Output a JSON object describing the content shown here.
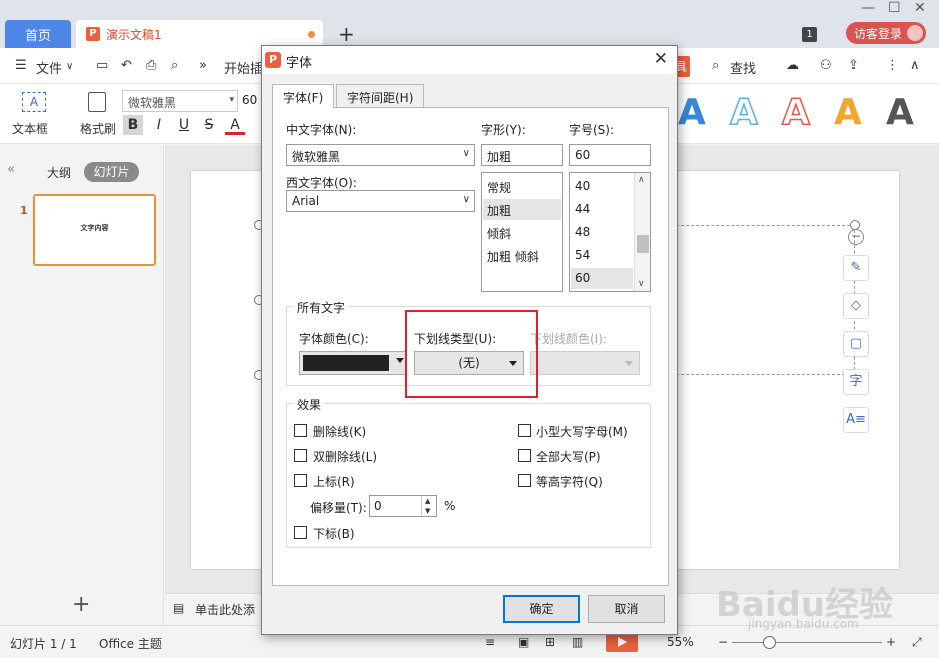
{
  "titlebar": {
    "home_tab": "首页",
    "doc_tab": "演示文稿1",
    "doc_icon": "P",
    "add_tab": "+",
    "badge": "1",
    "login": "访客登录"
  },
  "menubar": {
    "file": "文件",
    "start": "开始",
    "insert_partial": "插",
    "tools_tag": "具",
    "search": "查找",
    "more": "»"
  },
  "ribbon": {
    "textbox_label": "文本框",
    "format_painter": "格式刷",
    "font_name": "微软雅黑",
    "font_size": "60",
    "bold": "B",
    "italic": "I",
    "underline": "U",
    "strike": "S",
    "color_a": "A",
    "art_letters": [
      "A",
      "A",
      "A",
      "A",
      "A"
    ],
    "art_colors": [
      "#3a86d8",
      "#5bb0e8",
      "#e8574e",
      "#f2a531",
      "#555555"
    ]
  },
  "leftpane": {
    "outline_tab": "大纲",
    "slides_tab": "幻灯片",
    "slide_number": "1",
    "thumb_text": "文字内容",
    "add_button": "+"
  },
  "notes": {
    "placeholder": "单击此处添"
  },
  "statusbar": {
    "slide_info": "幻灯片 1 / 1",
    "theme": "Office 主题",
    "zoom": "55%",
    "minus": "−",
    "plus": "+"
  },
  "watermark": {
    "main": "Baidu经验",
    "sub": "jingyan.baidu.com"
  },
  "dialog": {
    "icon": "P",
    "title": "字体",
    "close": "✕",
    "tabs": [
      {
        "label": "字体(F)",
        "active": true
      },
      {
        "label": "字符间距(H)",
        "active": false
      }
    ],
    "chinese_font_label": "中文字体(N):",
    "chinese_font_value": "微软雅黑",
    "western_font_label": "西文字体(O):",
    "western_font_value": "Arial",
    "style_label": "字形(Y):",
    "style_value": "加粗",
    "style_options": [
      "常规",
      "加粗",
      "倾斜",
      "加粗 倾斜"
    ],
    "style_selected": "加粗",
    "size_label": "字号(S):",
    "size_value": "60",
    "size_options": [
      "40",
      "44",
      "48",
      "54",
      "60"
    ],
    "size_selected": "60",
    "all_text_group": "所有文字",
    "font_color_label": "字体颜色(C):",
    "font_color_value": "#222222",
    "underline_type_label": "下划线类型(U):",
    "underline_type_value": "(无)",
    "underline_color_label": "下划线颜色(I):",
    "effects_group": "效果",
    "effects_left": [
      {
        "label": "删除线(K)",
        "checked": false
      },
      {
        "label": "双删除线(L)",
        "checked": false
      },
      {
        "label": "上标(R)",
        "checked": false
      }
    ],
    "offset_label": "偏移量(T):",
    "offset_value": "0",
    "offset_unit": "%",
    "subscript": {
      "label": "下标(B)",
      "checked": false
    },
    "effects_right": [
      {
        "label": "小型大写字母(M)",
        "checked": false
      },
      {
        "label": "全部大写(P)",
        "checked": false
      },
      {
        "label": "等高字符(Q)",
        "checked": false
      }
    ],
    "ok": "确定",
    "cancel": "取消",
    "highlight_color": "#d9232d"
  }
}
